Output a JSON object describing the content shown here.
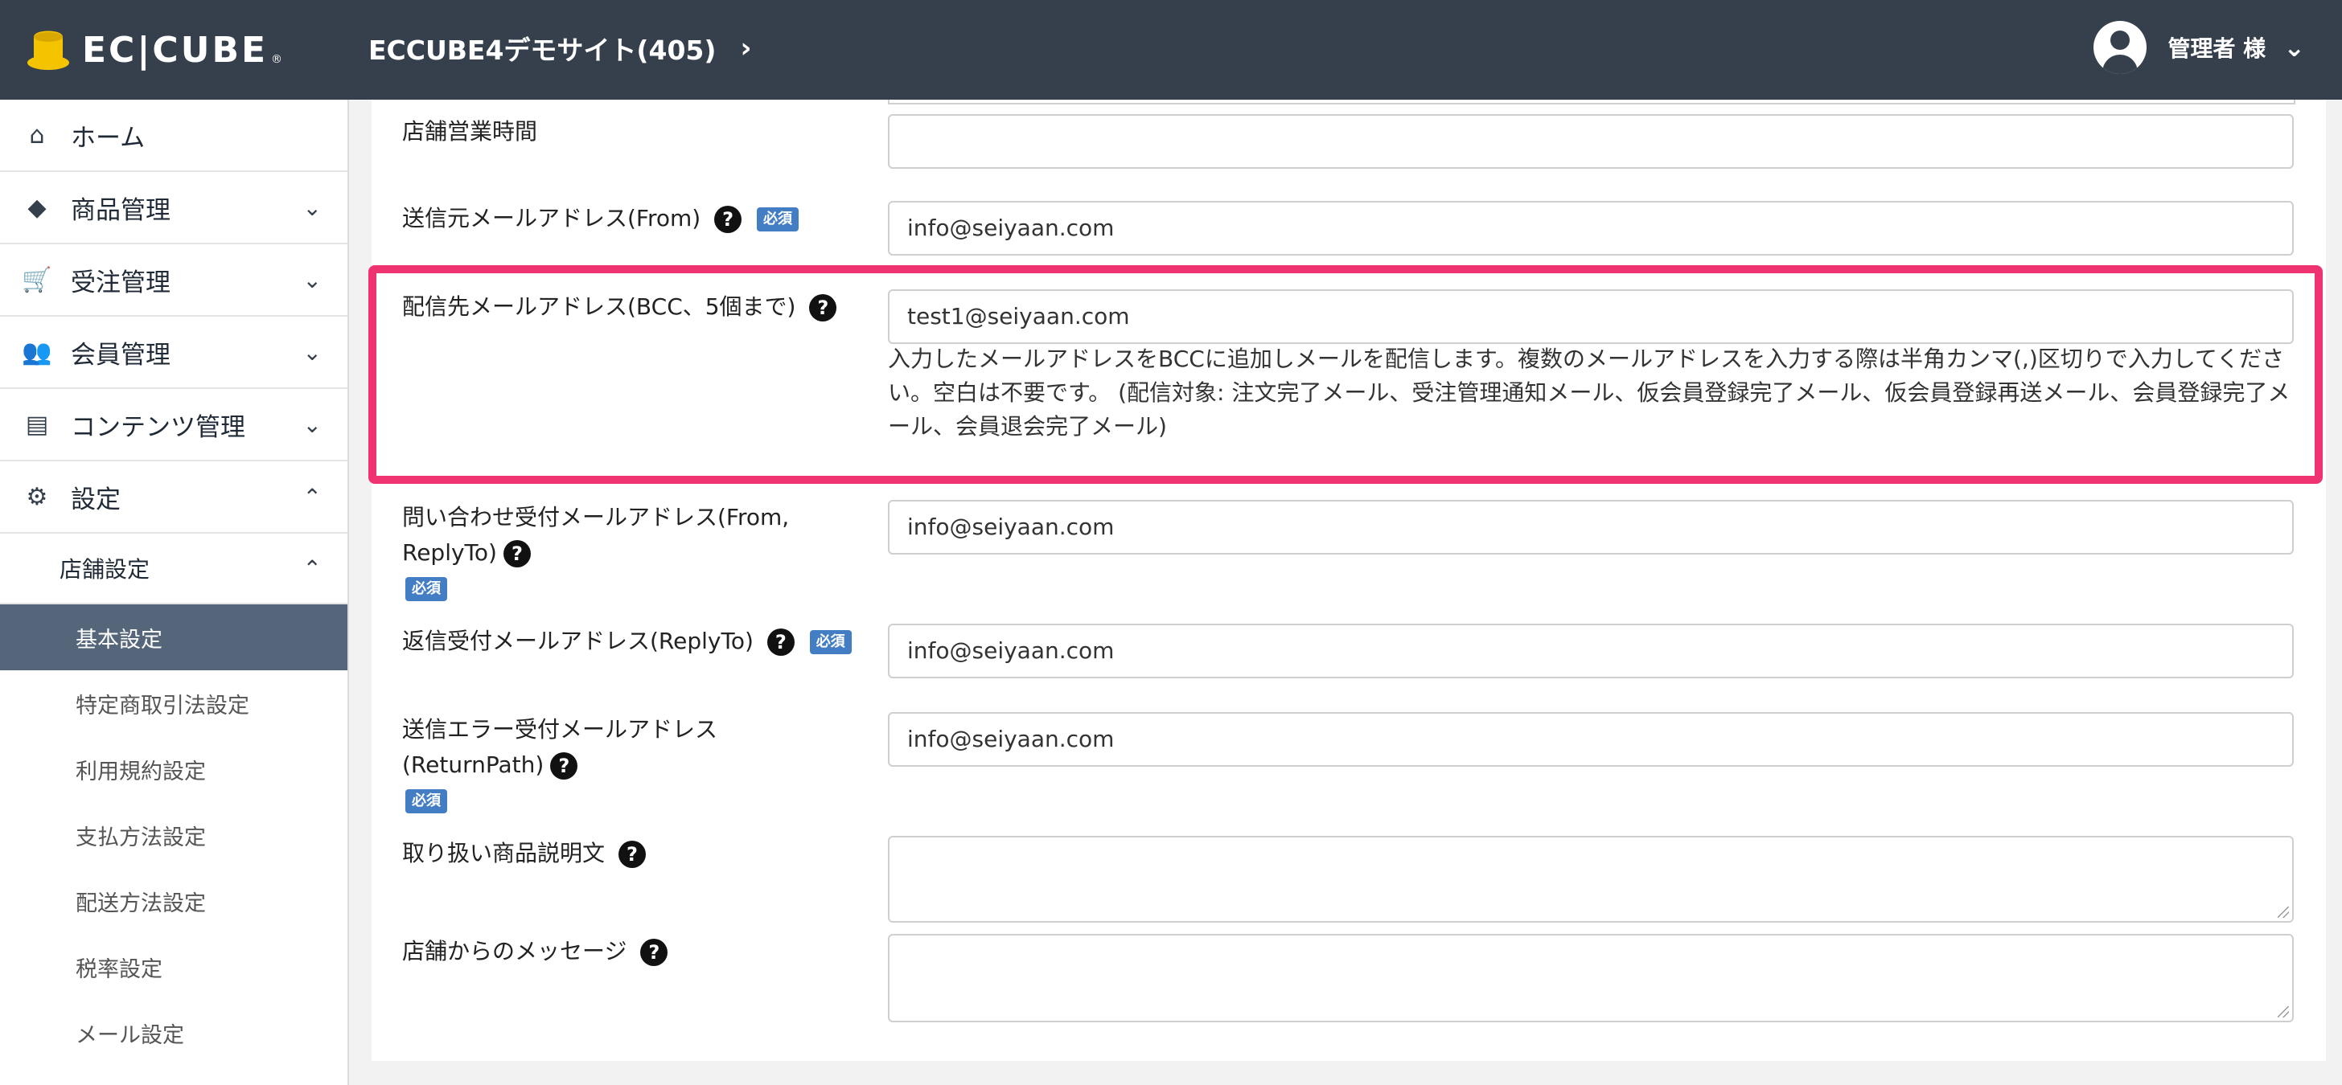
{
  "header": {
    "logo_text": "EC|CUBE",
    "logo_mark": "®",
    "site_title": "ECCUBE4デモサイト(405)",
    "user_name": "管理者 様"
  },
  "sidebar": {
    "items": [
      {
        "label": "ホーム",
        "icon": "home-icon"
      },
      {
        "label": "商品管理",
        "icon": "cube-icon"
      },
      {
        "label": "受注管理",
        "icon": "cart-icon"
      },
      {
        "label": "会員管理",
        "icon": "users-icon"
      },
      {
        "label": "コンテンツ管理",
        "icon": "file-icon"
      },
      {
        "label": "設定",
        "icon": "gear-icon"
      }
    ],
    "submenu_title": "店舗設定",
    "submenu_items": [
      "基本設定",
      "特定商取引法設定",
      "利用規約設定",
      "支払方法設定",
      "配送方法設定",
      "税率設定",
      "メール設定"
    ],
    "active_index": 0
  },
  "form": {
    "required_badge": "必須",
    "business_hours_label": "店舗営業時間",
    "business_hours_value": "",
    "from_email_label": "送信元メールアドレス(From)",
    "from_email_value": "info@seiyaan.com",
    "bcc_label": "配信先メールアドレス(BCC、5個まで)",
    "bcc_value": "test1@seiyaan.com",
    "bcc_help": "入力したメールアドレスをBCCに追加しメールを配信します。複数のメールアドレスを入力する際は半角カンマ(,)区切りで入力してください。空白は不要です。 (配信対象: 注文完了メール、受注管理通知メール、仮会員登録完了メール、仮会員登録再送メール、会員登録完了メール、会員退会完了メール)",
    "inquiry_label_line1": "問い合わせ受付メールアドレス(From,",
    "inquiry_label_line2": "ReplyTo)",
    "inquiry_value": "info@seiyaan.com",
    "reply_label": "返信受付メールアドレス(ReplyTo)",
    "reply_value": "info@seiyaan.com",
    "error_label_line1": "送信エラー受付メールアドレス",
    "error_label_line2": "(ReturnPath)",
    "error_value": "info@seiyaan.com",
    "product_desc_label": "取り扱い商品説明文",
    "shop_message_label": "店舗からのメッセージ"
  },
  "colors": {
    "header_bg": "#36404d",
    "active_menu_bg": "#56667a",
    "highlight": "#ef3370",
    "badge": "#437ec4"
  }
}
